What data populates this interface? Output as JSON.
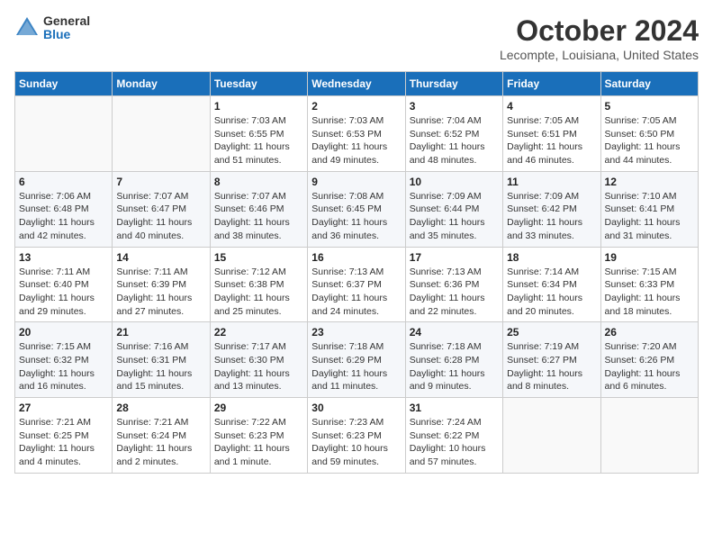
{
  "header": {
    "logo_general": "General",
    "logo_blue": "Blue",
    "month": "October 2024",
    "location": "Lecompte, Louisiana, United States"
  },
  "weekdays": [
    "Sunday",
    "Monday",
    "Tuesday",
    "Wednesday",
    "Thursday",
    "Friday",
    "Saturday"
  ],
  "weeks": [
    [
      {
        "day": "",
        "info": ""
      },
      {
        "day": "",
        "info": ""
      },
      {
        "day": "1",
        "info": "Sunrise: 7:03 AM\nSunset: 6:55 PM\nDaylight: 11 hours and 51 minutes."
      },
      {
        "day": "2",
        "info": "Sunrise: 7:03 AM\nSunset: 6:53 PM\nDaylight: 11 hours and 49 minutes."
      },
      {
        "day": "3",
        "info": "Sunrise: 7:04 AM\nSunset: 6:52 PM\nDaylight: 11 hours and 48 minutes."
      },
      {
        "day": "4",
        "info": "Sunrise: 7:05 AM\nSunset: 6:51 PM\nDaylight: 11 hours and 46 minutes."
      },
      {
        "day": "5",
        "info": "Sunrise: 7:05 AM\nSunset: 6:50 PM\nDaylight: 11 hours and 44 minutes."
      }
    ],
    [
      {
        "day": "6",
        "info": "Sunrise: 7:06 AM\nSunset: 6:48 PM\nDaylight: 11 hours and 42 minutes."
      },
      {
        "day": "7",
        "info": "Sunrise: 7:07 AM\nSunset: 6:47 PM\nDaylight: 11 hours and 40 minutes."
      },
      {
        "day": "8",
        "info": "Sunrise: 7:07 AM\nSunset: 6:46 PM\nDaylight: 11 hours and 38 minutes."
      },
      {
        "day": "9",
        "info": "Sunrise: 7:08 AM\nSunset: 6:45 PM\nDaylight: 11 hours and 36 minutes."
      },
      {
        "day": "10",
        "info": "Sunrise: 7:09 AM\nSunset: 6:44 PM\nDaylight: 11 hours and 35 minutes."
      },
      {
        "day": "11",
        "info": "Sunrise: 7:09 AM\nSunset: 6:42 PM\nDaylight: 11 hours and 33 minutes."
      },
      {
        "day": "12",
        "info": "Sunrise: 7:10 AM\nSunset: 6:41 PM\nDaylight: 11 hours and 31 minutes."
      }
    ],
    [
      {
        "day": "13",
        "info": "Sunrise: 7:11 AM\nSunset: 6:40 PM\nDaylight: 11 hours and 29 minutes."
      },
      {
        "day": "14",
        "info": "Sunrise: 7:11 AM\nSunset: 6:39 PM\nDaylight: 11 hours and 27 minutes."
      },
      {
        "day": "15",
        "info": "Sunrise: 7:12 AM\nSunset: 6:38 PM\nDaylight: 11 hours and 25 minutes."
      },
      {
        "day": "16",
        "info": "Sunrise: 7:13 AM\nSunset: 6:37 PM\nDaylight: 11 hours and 24 minutes."
      },
      {
        "day": "17",
        "info": "Sunrise: 7:13 AM\nSunset: 6:36 PM\nDaylight: 11 hours and 22 minutes."
      },
      {
        "day": "18",
        "info": "Sunrise: 7:14 AM\nSunset: 6:34 PM\nDaylight: 11 hours and 20 minutes."
      },
      {
        "day": "19",
        "info": "Sunrise: 7:15 AM\nSunset: 6:33 PM\nDaylight: 11 hours and 18 minutes."
      }
    ],
    [
      {
        "day": "20",
        "info": "Sunrise: 7:15 AM\nSunset: 6:32 PM\nDaylight: 11 hours and 16 minutes."
      },
      {
        "day": "21",
        "info": "Sunrise: 7:16 AM\nSunset: 6:31 PM\nDaylight: 11 hours and 15 minutes."
      },
      {
        "day": "22",
        "info": "Sunrise: 7:17 AM\nSunset: 6:30 PM\nDaylight: 11 hours and 13 minutes."
      },
      {
        "day": "23",
        "info": "Sunrise: 7:18 AM\nSunset: 6:29 PM\nDaylight: 11 hours and 11 minutes."
      },
      {
        "day": "24",
        "info": "Sunrise: 7:18 AM\nSunset: 6:28 PM\nDaylight: 11 hours and 9 minutes."
      },
      {
        "day": "25",
        "info": "Sunrise: 7:19 AM\nSunset: 6:27 PM\nDaylight: 11 hours and 8 minutes."
      },
      {
        "day": "26",
        "info": "Sunrise: 7:20 AM\nSunset: 6:26 PM\nDaylight: 11 hours and 6 minutes."
      }
    ],
    [
      {
        "day": "27",
        "info": "Sunrise: 7:21 AM\nSunset: 6:25 PM\nDaylight: 11 hours and 4 minutes."
      },
      {
        "day": "28",
        "info": "Sunrise: 7:21 AM\nSunset: 6:24 PM\nDaylight: 11 hours and 2 minutes."
      },
      {
        "day": "29",
        "info": "Sunrise: 7:22 AM\nSunset: 6:23 PM\nDaylight: 11 hours and 1 minute."
      },
      {
        "day": "30",
        "info": "Sunrise: 7:23 AM\nSunset: 6:23 PM\nDaylight: 10 hours and 59 minutes."
      },
      {
        "day": "31",
        "info": "Sunrise: 7:24 AM\nSunset: 6:22 PM\nDaylight: 10 hours and 57 minutes."
      },
      {
        "day": "",
        "info": ""
      },
      {
        "day": "",
        "info": ""
      }
    ]
  ]
}
